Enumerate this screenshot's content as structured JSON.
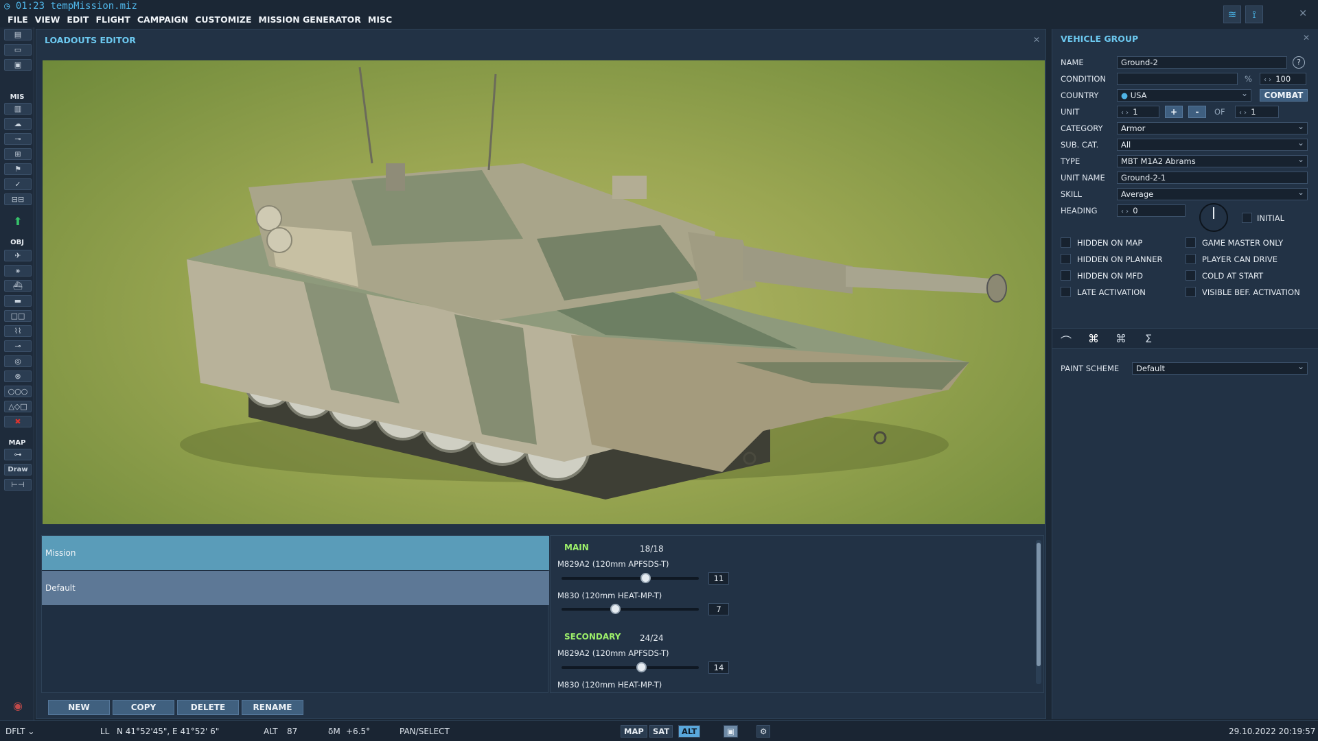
{
  "app": {
    "time": "01:23",
    "file": "tempMission.miz",
    "menu": [
      "FILE",
      "VIEW",
      "EDIT",
      "FLIGHT",
      "CAMPAIGN",
      "CUSTOMIZE",
      "MISSION GENERATOR",
      "MISC"
    ]
  },
  "toolbar": {
    "section_mis": "MIS",
    "section_obj": "OBJ",
    "section_map": "MAP",
    "draw_label": "Draw"
  },
  "loadouts": {
    "title": "LOADOUTS EDITOR",
    "list": [
      "Mission",
      "Default"
    ],
    "buttons": {
      "new": "NEW",
      "copy": "COPY",
      "delete": "DELETE",
      "rename": "RENAME"
    },
    "main": {
      "label": "MAIN",
      "count": "18/18",
      "items": [
        {
          "name": "M829A2 (120mm APFSDS-T)",
          "value": "11",
          "fraction": 0.61
        },
        {
          "name": "M830 (120mm HEAT-MP-T)",
          "value": "7",
          "fraction": 0.39
        }
      ]
    },
    "secondary": {
      "label": "SECONDARY",
      "count": "24/24",
      "items": [
        {
          "name": "M829A2 (120mm APFSDS-T)",
          "value": "14",
          "fraction": 0.58
        },
        {
          "name": "M830 (120mm HEAT-MP-T)",
          "value": "",
          "fraction": 0.42
        }
      ]
    }
  },
  "vehicle_group": {
    "title": "VEHICLE GROUP",
    "labels": {
      "name": "NAME",
      "condition": "CONDITION",
      "country": "COUNTRY",
      "unit": "UNIT",
      "category": "CATEGORY",
      "sub_cat": "SUB. CAT.",
      "type": "TYPE",
      "unit_name": "UNIT NAME",
      "skill": "SKILL",
      "heading": "HEADING",
      "of": "OF",
      "percent": "%",
      "initial": "INITIAL",
      "paint_scheme": "PAINT SCHEME"
    },
    "values": {
      "name": "Ground-2",
      "condition": "100",
      "country": "USA",
      "combat": "COMBAT",
      "unit": "1",
      "unit_of": "1",
      "category": "Armor",
      "sub_cat": "All",
      "type": "MBT M1A2 Abrams",
      "unit_name": "Ground-2-1",
      "skill": "Average",
      "heading": "0",
      "paint_scheme": "Default"
    },
    "checks_left": [
      "HIDDEN ON MAP",
      "HIDDEN ON PLANNER",
      "HIDDEN ON MFD",
      "LATE ACTIVATION"
    ],
    "checks_right": [
      "GAME MASTER ONLY",
      "PLAYER CAN DRIVE",
      "COLD AT START",
      "VISIBLE BEF. ACTIVATION"
    ]
  },
  "status": {
    "profile": "DFLT",
    "coord_label": "LL",
    "coords": "N 41°52'45\", E 41°52' 6\"",
    "alt_label": "ALT",
    "alt": "87",
    "mag_label": "δM",
    "mag": "+6.5°",
    "mode": "PAN/SELECT",
    "map_buttons": [
      "MAP",
      "SAT",
      "ALT"
    ],
    "datetime": "29.10.2022 20:19:57"
  },
  "colors": {
    "accent": "#6cc8ef",
    "green_label": "#9df06a",
    "selected_row": "#5a9cb9"
  }
}
